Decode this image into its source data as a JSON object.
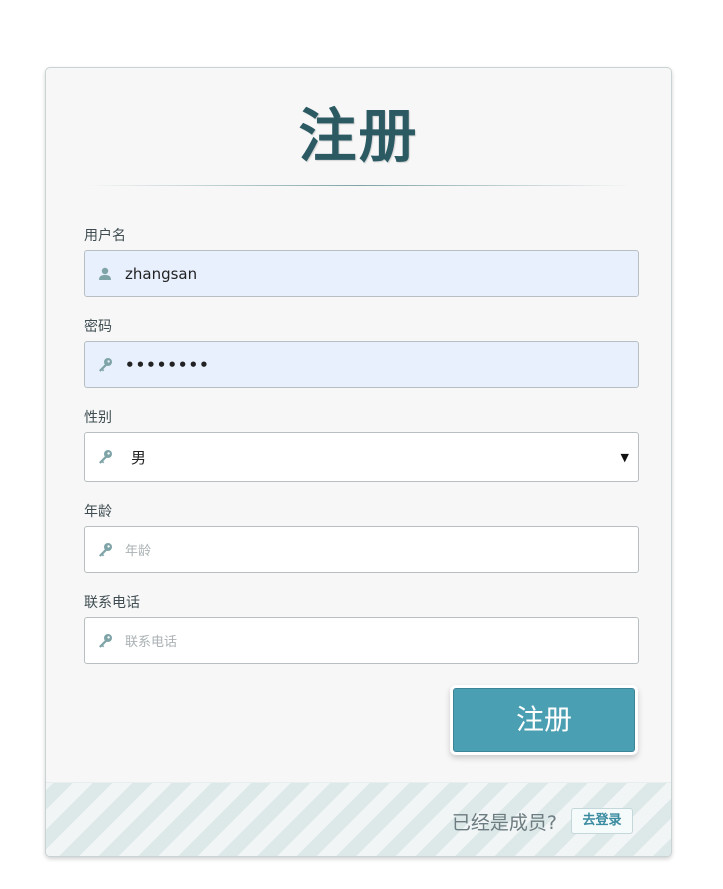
{
  "form": {
    "title": "注册",
    "username": {
      "label": "用户名",
      "value": "zhangsan",
      "icon": "user-icon"
    },
    "password": {
      "label": "密码",
      "value": "••••••••",
      "icon": "key-icon"
    },
    "gender": {
      "label": "性别",
      "selected": "男",
      "icon": "key-icon",
      "arrow": "▼"
    },
    "age": {
      "label": "年龄",
      "placeholder": "年龄",
      "icon": "key-icon"
    },
    "phone": {
      "label": "联系电话",
      "placeholder": "联系电话",
      "icon": "key-icon"
    },
    "submit_label": "注册"
  },
  "footer": {
    "prompt": "已经是成员?",
    "login_label": "去登录"
  },
  "colors": {
    "accent": "#4a9fb3",
    "title": "#2c5a63",
    "icon": "#7fa4a8"
  }
}
